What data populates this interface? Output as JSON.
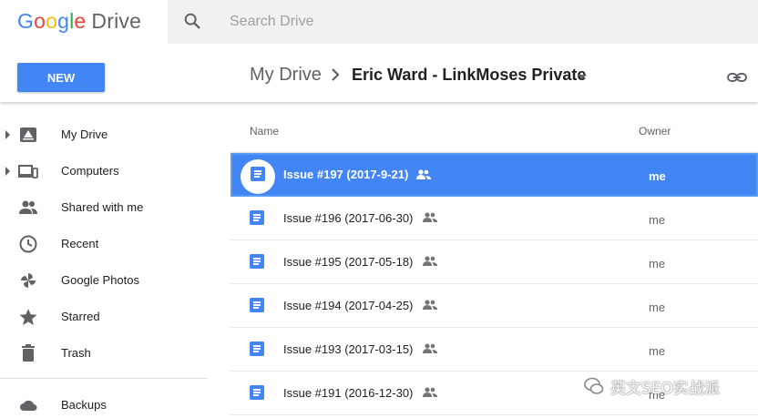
{
  "app": {
    "logo_google": [
      "G",
      "o",
      "o",
      "g",
      "l",
      "e"
    ],
    "logo_product": "Drive"
  },
  "search": {
    "placeholder": "Search Drive",
    "value": ""
  },
  "toolbar": {
    "new_label": "NEW"
  },
  "breadcrumb": {
    "root": "My Drive",
    "current": "Eric Ward - LinkMoses Private"
  },
  "sidebar": {
    "items": [
      {
        "label": "My Drive",
        "icon": "my-drive-icon",
        "expandable": true
      },
      {
        "label": "Computers",
        "icon": "computers-icon",
        "expandable": true
      },
      {
        "label": "Shared with me",
        "icon": "shared-with-me-icon",
        "expandable": false
      },
      {
        "label": "Recent",
        "icon": "clock-icon",
        "expandable": false
      },
      {
        "label": "Google Photos",
        "icon": "pinwheel-icon",
        "expandable": false
      },
      {
        "label": "Starred",
        "icon": "star-icon",
        "expandable": false
      },
      {
        "label": "Trash",
        "icon": "trash-icon",
        "expandable": false
      },
      {
        "label": "Backups",
        "icon": "cloud-icon",
        "expandable": false
      }
    ]
  },
  "list": {
    "columns": {
      "name": "Name",
      "owner": "Owner"
    },
    "rows": [
      {
        "name": "Issue #197 (2017-9-21)",
        "owner": "me",
        "shared": true,
        "selected": true
      },
      {
        "name": "Issue #196 (2017-06-30)",
        "owner": "me",
        "shared": true,
        "selected": false
      },
      {
        "name": "Issue #195 (2017-05-18)",
        "owner": "me",
        "shared": true,
        "selected": false
      },
      {
        "name": "Issue #194 (2017-04-25)",
        "owner": "me",
        "shared": true,
        "selected": false
      },
      {
        "name": "Issue #193 (2017-03-15)",
        "owner": "me",
        "shared": true,
        "selected": false
      },
      {
        "name": "Issue #191 (2016-12-30)",
        "owner": "me",
        "shared": true,
        "selected": false
      }
    ]
  },
  "watermark": {
    "text": "英文SEO实战派"
  },
  "colors": {
    "accent": "#4285f4",
    "selected_row": "#4285f4"
  }
}
